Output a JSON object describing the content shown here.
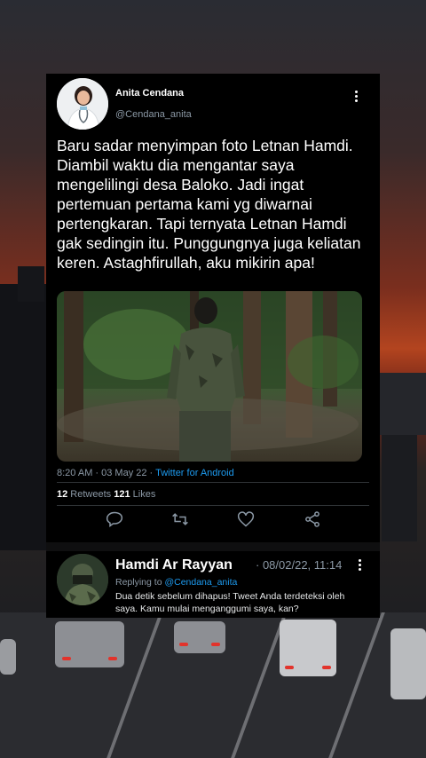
{
  "tweet": {
    "author_name": "Anita Cendana",
    "author_handle": "@Cendana_anita",
    "text": "Baru sadar menyimpan foto Letnan Hamdi. Diambil waktu dia mengantar saya mengelilingi desa Baloko. Jadi ingat pertemuan pertama kami yg diwarnai pertengkaran. Tapi ternyata Letnan Hamdi gak sedingin itu. Punggungnya juga keliatan keren. Astaghfirullah, aku mikirin apa!",
    "time": "8:20 AM · 03 May 22 · ",
    "source": "Twitter for Android",
    "retweets_count": "12",
    "retweets_label": " Retweets ",
    "likes_count": "121",
    "likes_label": " Likes"
  },
  "actions": [
    "reply-icon",
    "retweet-icon",
    "like-icon",
    "share-icon"
  ],
  "reply": {
    "author_name": "Hamdi Ar Rayyan",
    "date": "· 08/02/22, 11:14",
    "replying_prefix": "Replying to ",
    "replying_handle": "@Cendana_anita",
    "text": "Dua detik sebelum dihapus! Tweet Anda terdeteksi oleh saya. Kamu mulai menganggumi saya, kan?"
  },
  "colors": {
    "link": "#1d9bf0",
    "muted": "#8b98a5",
    "card": "#000000"
  }
}
